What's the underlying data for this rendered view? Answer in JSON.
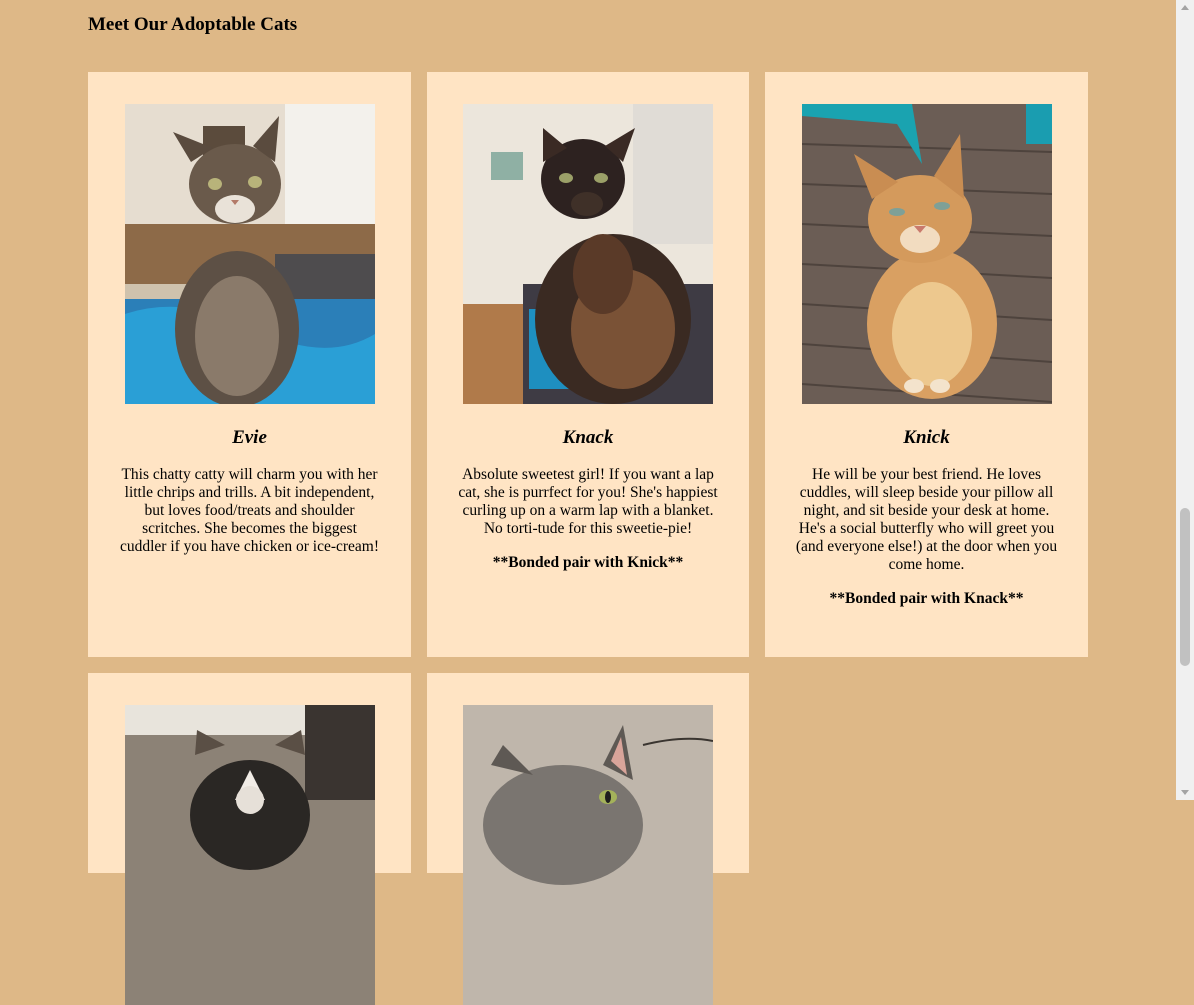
{
  "heading": "Meet Our Adoptable Cats",
  "cats": [
    {
      "name": "Evie",
      "photo": "tabby-cat-photo",
      "description": "This chatty catty will charm you with her little chrips and trills. A bit independent, but loves food/treats and shoulder scritches. She becomes the biggest cuddler if you have chicken or ice-cream!",
      "note": ""
    },
    {
      "name": "Knack",
      "photo": "tortoiseshell-cat-photo",
      "description": "Absolute sweetest girl! If you want a lap cat, she is purrfect for you! She's happiest curling up on a warm lap with a blanket. No torti-tude for this sweetie-pie!",
      "note": "**Bonded pair with Knick**"
    },
    {
      "name": "Knick",
      "photo": "orange-tabby-cat-photo",
      "description": "He will be your best friend. He loves cuddles, will sleep beside your pillow all night, and sit beside your desk at home. He's a social butterfly who will greet you (and everyone else!) at the door when you come home.",
      "note": "**Bonded pair with Knack**"
    },
    {
      "photo": "dark-tabby-cat-photo"
    },
    {
      "photo": "gray-tabby-cat-photo"
    }
  ],
  "colors": {
    "page_background": "#deb887",
    "card_background": "#ffe4c4"
  }
}
